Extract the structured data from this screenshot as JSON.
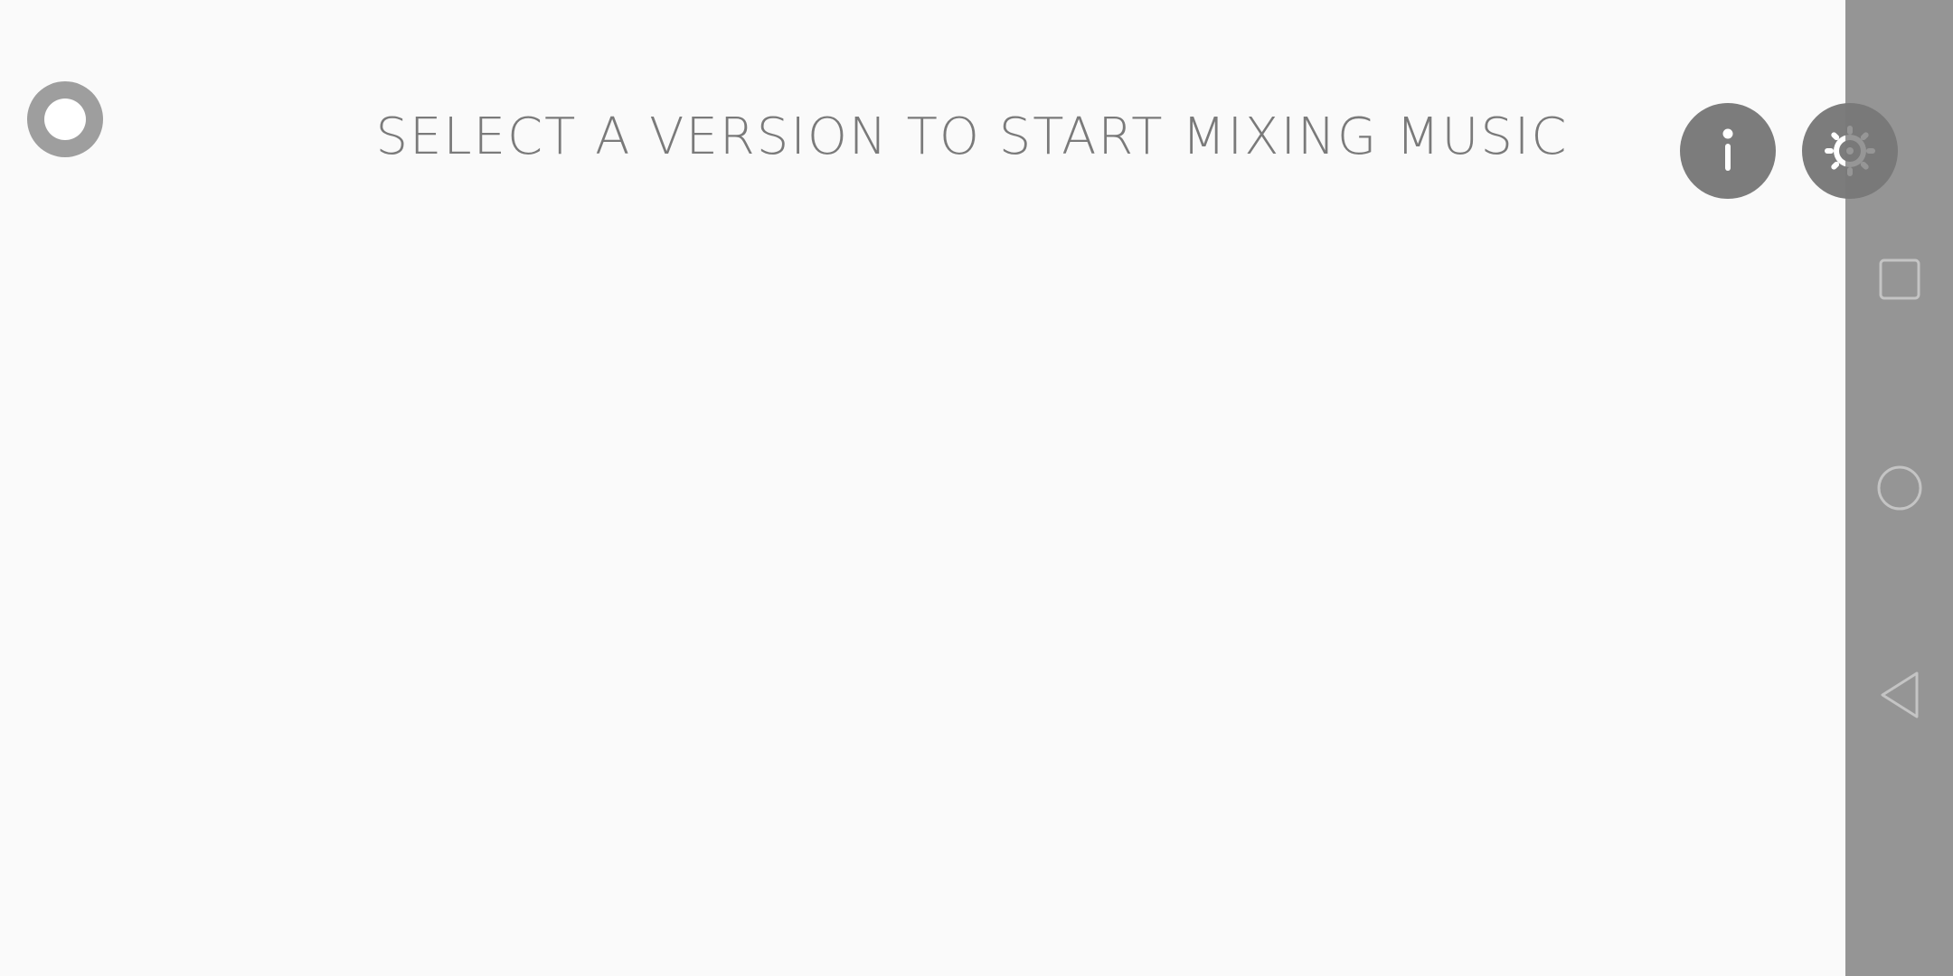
{
  "app": {
    "headline": "SELECT A VERSION TO START MIXING MUSIC",
    "buttons": {
      "info_icon": "info-icon",
      "settings_icon": "gear-icon"
    },
    "status_indicator_icon": "record-indicator-icon"
  },
  "system_nav": {
    "recents_icon": "square-icon",
    "home_icon": "circle-icon",
    "back_icon": "triangle-back-icon"
  },
  "colors": {
    "background": "#fafafa",
    "text": "#7a7a7a",
    "button_fill": "#7c7c7c",
    "nav_bar": "#949494",
    "nav_icon_stroke": "#c4c4c4"
  }
}
